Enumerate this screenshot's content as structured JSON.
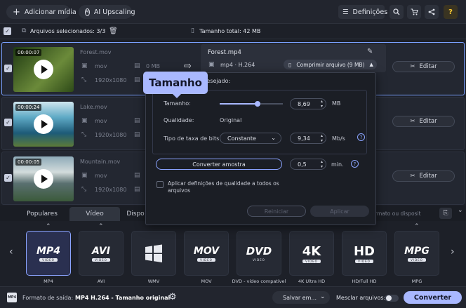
{
  "topbar": {
    "add_media_label": "Adicionar mídia",
    "ai_upscaling_label": "AI Upscaling",
    "settings_label": "Definições"
  },
  "subbar": {
    "selected_files": "Arquivos selecionados: 3/3",
    "total_size_label": "Tamanho total: 42 MB"
  },
  "files": [
    {
      "duration": "00:00:07",
      "name": "Forest.mov",
      "format": "mov",
      "size": "0 MB",
      "resolution": "1920x1080",
      "edit_label": "Editar",
      "colors": [
        "#2e4a18",
        "#6b8a3a"
      ]
    },
    {
      "duration": "00:00:24",
      "name": "Lake.mov",
      "format": "mov",
      "size": "",
      "resolution": "1920x1080",
      "edit_label": "Editar",
      "colors": [
        "#2d6c86",
        "#9fd0e2"
      ]
    },
    {
      "duration": "00:00:05",
      "name": "Mountain.mov",
      "format": "mov",
      "size": "",
      "resolution": "1920x1080",
      "edit_label": "Editar",
      "colors": [
        "#3b5a6e",
        "#a8b7ba"
      ]
    }
  ],
  "output_card": {
    "filename": "Forest.mp4",
    "codec": "mp4 · H.264",
    "compress_label": "Comprimir arquivo (9 MB)"
  },
  "tooltip": "Tamanho",
  "compress_popup": {
    "desired_label": "e saída desejado:",
    "size_label": "Tamanho:",
    "size_value": "8,69",
    "size_unit": "MB",
    "size_slider_fraction": 0.6,
    "quality_label": "Qualidade:",
    "quality_value": "Original",
    "bitrate_label": "Tipo de taxa de bits:",
    "bitrate_type": "Constante",
    "bitrate_value": "9,34",
    "bitrate_unit": "Mb/s",
    "sample_button": "Converter amostra",
    "sample_value": "0,5",
    "sample_unit": "min.",
    "apply_all_label": "Aplicar definições de qualidade a todos os arquivos",
    "reset_button": "Reiniciar",
    "apply_button": "Aplicar"
  },
  "tabs": {
    "popular": "Populares",
    "video": "Vídeo",
    "devices": "Dispo",
    "search_placeholder": "rmato ou disposit"
  },
  "formats": [
    {
      "name": "MP4",
      "label": "MP4"
    },
    {
      "name": "AVI",
      "label": "AVI"
    },
    {
      "name": "WMV",
      "label": "WMV"
    },
    {
      "name": "MOV",
      "label": "MOV"
    },
    {
      "name": "DVD",
      "label": "DVD - vídeo compatível"
    },
    {
      "name": "4K",
      "label": "4K Ultra HD"
    },
    {
      "name": "HD",
      "label": "HD/Full HD"
    },
    {
      "name": "MPG",
      "label": "MPG"
    }
  ],
  "bottombar": {
    "output_format_prefix": "Formato de saída:",
    "output_format_value": "MP4 H.264 - Tamanho original",
    "save_label": "Salvar em...",
    "merge_label": "Mesclar arquivos:",
    "convert_label": "Converter"
  },
  "colors": {
    "accent": "#a9b8ff",
    "panel": "#232731",
    "background": "#1d2028"
  }
}
